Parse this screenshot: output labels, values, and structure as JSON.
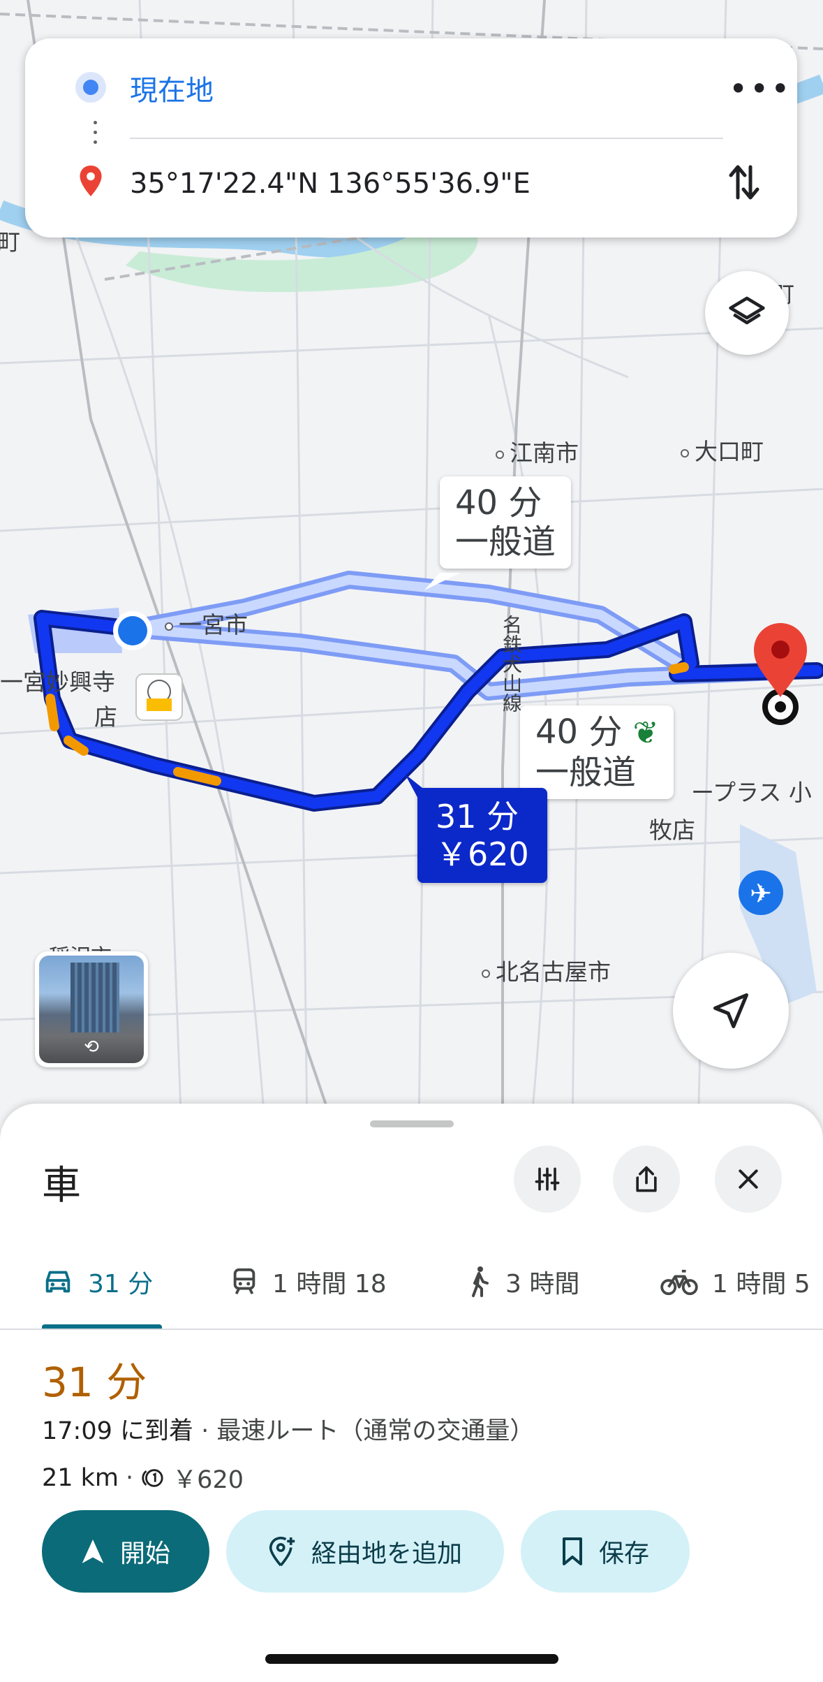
{
  "directions": {
    "origin": "現在地",
    "destination": "35°17'22.4\"N 136°55'36.9\"E"
  },
  "map": {
    "places": {
      "konan": "江南市",
      "oguchi": "大口町",
      "ichinomiya": "一宮市",
      "myokoji": "一宮妙興寺",
      "myokoji_store": "店",
      "kitanagoya": "北名古屋市",
      "komaki_store_1": "ープラス 小",
      "komaki_store_2": "牧店",
      "railway": "名鉄犬山線",
      "top_fragment": "町",
      "left_fragment": "笠松町",
      "bottom_fragment": "稲沢市"
    },
    "route_bubbles": {
      "alt1_time": "40 分",
      "alt1_type": "一般道",
      "alt2_time": "40 分",
      "alt2_type": "一般道",
      "selected_time": "31 分",
      "selected_toll": "￥620"
    }
  },
  "sheet": {
    "mode_title": "車",
    "tabs": [
      {
        "label": "31 分",
        "mode": "drive",
        "active": true
      },
      {
        "label": "1 時間 18",
        "mode": "transit"
      },
      {
        "label": "3 時間",
        "mode": "walk"
      },
      {
        "label": "1 時間 5",
        "mode": "bike"
      }
    ],
    "duration": "31 分",
    "arrival": "17:09 に到着",
    "route_desc": "· 最速ルート（通常の交通量）",
    "distance": "21 km",
    "separator": "·",
    "toll": "￥620",
    "actions": {
      "start": "開始",
      "add_waypoint": "経由地を追加",
      "save": "保存"
    }
  },
  "colors": {
    "route_selected": "#0b28c9",
    "route_alt": "#a9c2ff",
    "accent": "#0b6b78",
    "traffic": "#f29900",
    "destination_pin": "#ea4335"
  }
}
